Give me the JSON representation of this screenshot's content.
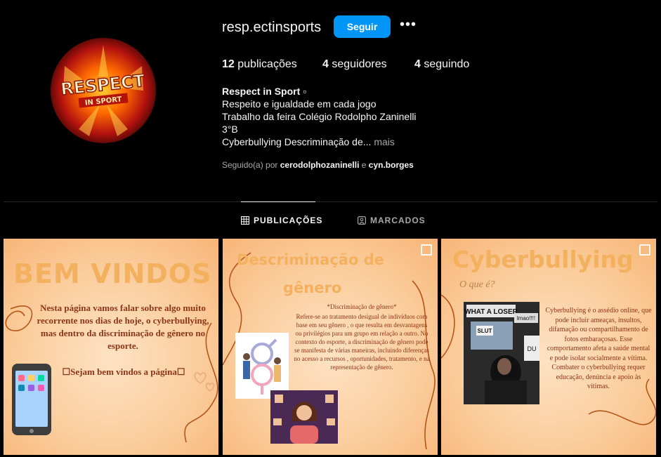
{
  "profile": {
    "username": "resp.ectinsports",
    "follow_label": "Seguir",
    "more_label": "•••",
    "avatar_logo": {
      "line1": "RESPECT",
      "line2": "IN SPORT"
    }
  },
  "stats": {
    "posts_count": "12",
    "posts_label": "publicações",
    "followers_count": "4",
    "followers_label": "seguidores",
    "following_count": "4",
    "following_label": "seguindo"
  },
  "bio": {
    "name": "Respect in Sport ▫",
    "line1": "Respeito e igualdade em cada jogo",
    "line2": "Trabalho da feira Colégio Rodolpho Zaninelli",
    "line3": "3°B",
    "line4": "Cyberbullying Descriminação de...",
    "more": "mais"
  },
  "followed_by": {
    "prefix": "Seguido(a) por",
    "user1": "cerodolphozaninelli",
    "conj": "e",
    "user2": "cyn.borges"
  },
  "tabs": [
    {
      "label": "PUBLICAÇÕES",
      "icon": "grid-icon",
      "active": true
    },
    {
      "label": "MARCADOS",
      "icon": "tagged-icon",
      "active": false
    }
  ],
  "posts": [
    {
      "title": "BEM VINDOS",
      "body": "Nesta página vamos falar sobre algo muito recorrente nos dias de hoje, o cyberbullying, mas dentro da discriminação de gênero no esporte.",
      "welcome": "☐Sejam bem vindos a página☐"
    },
    {
      "title_line1": "Descriminação de",
      "title_line2": "gênero",
      "subtitle": "*Discriminação de gênero*",
      "body": "Refere-se ao tratamento desigual de indivíduos com base em seu gênero , o que resulta em desvantagens ou privilégios para um grupo em relação a outro. No contexto do esporte, a discriminação de gênero pode se manifesta de várias maneiras, incluindo diferenças no acesso a recursos , oportunidades, tratamento, e na representação de gênero."
    },
    {
      "title": "Cyberbullying",
      "subtitle": "O que é?",
      "body": "Cyberbullying é o assédio online, que pode incluir ameaças, insultos, difamação ou compartilhamento de fotos embaraçosas. Esse comportamento afeta a saúde mental e pode isolar socialmente a vítima. Combater o cyberbullying requer educação, denúncia e apoio às vítimas.",
      "photo_text": {
        "t1": "WHAT A LOSER",
        "t2": "SLUT",
        "t3": "lmao!!!!",
        "t4": "DU"
      }
    }
  ],
  "colors": {
    "accent": "#0095f6",
    "background": "#000000",
    "post_bg": "#fbcd9d",
    "post_title": "#f3b05f"
  }
}
